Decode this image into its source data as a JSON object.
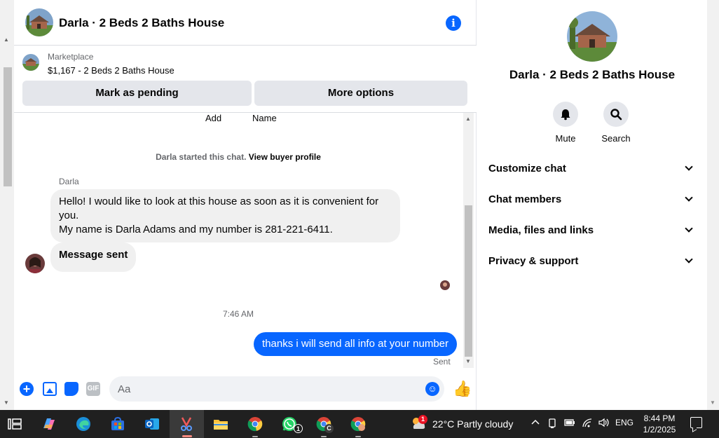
{
  "header": {
    "title": "Darla · 2 Beds 2 Baths House"
  },
  "listing": {
    "source": "Marketplace",
    "summary": "$1,167 - 2 Beds 2 Baths House",
    "pending_label": "Mark as pending",
    "more_label": "More options"
  },
  "thread": {
    "partial_left": "Add",
    "partial_right": "Name",
    "started_text": "Darla started this chat.",
    "buyer_link": "View buyer profile",
    "sender_name": "Darla",
    "message_1_line1": "Hello! I would like to look at this house as soon as it is convenient for you.",
    "message_1_line2": "My name is Darla Adams and my number is 281-221-6411.",
    "message_2": "Message sent",
    "timestamp": "7:46 AM",
    "reply": "thanks i will send all info at your number",
    "status": "Sent"
  },
  "composer": {
    "placeholder": "Aa",
    "gif_label": "GIF",
    "plus_glyph": "+",
    "emoji_glyph": "☺",
    "like_glyph": "👍"
  },
  "panel": {
    "title": "Darla · 2 Beds 2 Baths House",
    "mute_label": "Mute",
    "search_label": "Search",
    "sections": [
      "Customize chat",
      "Chat members",
      "Media, files and links",
      "Privacy & support"
    ]
  },
  "taskbar": {
    "weather": "22°C  Partly cloudy",
    "language": "ENG",
    "time": "8:44 PM",
    "date": "1/2/2025",
    "whatsapp_badge": "1",
    "weather_badge": "1",
    "chrome_profile_letter": "C"
  },
  "colors": {
    "accent": "#0866ff",
    "bubble_in": "#f0f0f0",
    "taskbar": "#202020"
  },
  "icons": [
    "info-icon",
    "plus-icon",
    "image-icon",
    "sticker-icon",
    "gif-icon",
    "emoji-icon",
    "like-icon",
    "bell-icon",
    "search-icon",
    "chevron-down-icon",
    "task-view-icon",
    "copilot-icon",
    "edge-icon",
    "store-icon",
    "outlook-icon",
    "snipping-tool-icon",
    "file-explorer-icon",
    "chrome-icon",
    "whatsapp-icon",
    "chrome-profile-icon",
    "weather-icon",
    "wifi-icon",
    "speaker-icon",
    "battery-icon",
    "notification-icon"
  ]
}
